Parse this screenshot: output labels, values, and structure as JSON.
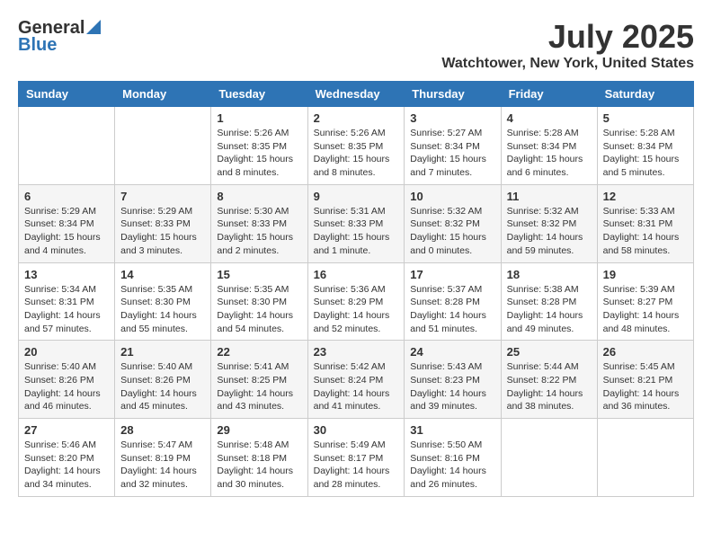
{
  "header": {
    "logo_general": "General",
    "logo_blue": "Blue",
    "title": "July 2025",
    "location": "Watchtower, New York, United States"
  },
  "calendar": {
    "days_of_week": [
      "Sunday",
      "Monday",
      "Tuesday",
      "Wednesday",
      "Thursday",
      "Friday",
      "Saturday"
    ],
    "weeks": [
      [
        {
          "day": "",
          "info": ""
        },
        {
          "day": "",
          "info": ""
        },
        {
          "day": "1",
          "info": "Sunrise: 5:26 AM\nSunset: 8:35 PM\nDaylight: 15 hours\nand 8 minutes."
        },
        {
          "day": "2",
          "info": "Sunrise: 5:26 AM\nSunset: 8:35 PM\nDaylight: 15 hours\nand 8 minutes."
        },
        {
          "day": "3",
          "info": "Sunrise: 5:27 AM\nSunset: 8:34 PM\nDaylight: 15 hours\nand 7 minutes."
        },
        {
          "day": "4",
          "info": "Sunrise: 5:28 AM\nSunset: 8:34 PM\nDaylight: 15 hours\nand 6 minutes."
        },
        {
          "day": "5",
          "info": "Sunrise: 5:28 AM\nSunset: 8:34 PM\nDaylight: 15 hours\nand 5 minutes."
        }
      ],
      [
        {
          "day": "6",
          "info": "Sunrise: 5:29 AM\nSunset: 8:34 PM\nDaylight: 15 hours\nand 4 minutes."
        },
        {
          "day": "7",
          "info": "Sunrise: 5:29 AM\nSunset: 8:33 PM\nDaylight: 15 hours\nand 3 minutes."
        },
        {
          "day": "8",
          "info": "Sunrise: 5:30 AM\nSunset: 8:33 PM\nDaylight: 15 hours\nand 2 minutes."
        },
        {
          "day": "9",
          "info": "Sunrise: 5:31 AM\nSunset: 8:33 PM\nDaylight: 15 hours\nand 1 minute."
        },
        {
          "day": "10",
          "info": "Sunrise: 5:32 AM\nSunset: 8:32 PM\nDaylight: 15 hours\nand 0 minutes."
        },
        {
          "day": "11",
          "info": "Sunrise: 5:32 AM\nSunset: 8:32 PM\nDaylight: 14 hours\nand 59 minutes."
        },
        {
          "day": "12",
          "info": "Sunrise: 5:33 AM\nSunset: 8:31 PM\nDaylight: 14 hours\nand 58 minutes."
        }
      ],
      [
        {
          "day": "13",
          "info": "Sunrise: 5:34 AM\nSunset: 8:31 PM\nDaylight: 14 hours\nand 57 minutes."
        },
        {
          "day": "14",
          "info": "Sunrise: 5:35 AM\nSunset: 8:30 PM\nDaylight: 14 hours\nand 55 minutes."
        },
        {
          "day": "15",
          "info": "Sunrise: 5:35 AM\nSunset: 8:30 PM\nDaylight: 14 hours\nand 54 minutes."
        },
        {
          "day": "16",
          "info": "Sunrise: 5:36 AM\nSunset: 8:29 PM\nDaylight: 14 hours\nand 52 minutes."
        },
        {
          "day": "17",
          "info": "Sunrise: 5:37 AM\nSunset: 8:28 PM\nDaylight: 14 hours\nand 51 minutes."
        },
        {
          "day": "18",
          "info": "Sunrise: 5:38 AM\nSunset: 8:28 PM\nDaylight: 14 hours\nand 49 minutes."
        },
        {
          "day": "19",
          "info": "Sunrise: 5:39 AM\nSunset: 8:27 PM\nDaylight: 14 hours\nand 48 minutes."
        }
      ],
      [
        {
          "day": "20",
          "info": "Sunrise: 5:40 AM\nSunset: 8:26 PM\nDaylight: 14 hours\nand 46 minutes."
        },
        {
          "day": "21",
          "info": "Sunrise: 5:40 AM\nSunset: 8:26 PM\nDaylight: 14 hours\nand 45 minutes."
        },
        {
          "day": "22",
          "info": "Sunrise: 5:41 AM\nSunset: 8:25 PM\nDaylight: 14 hours\nand 43 minutes."
        },
        {
          "day": "23",
          "info": "Sunrise: 5:42 AM\nSunset: 8:24 PM\nDaylight: 14 hours\nand 41 minutes."
        },
        {
          "day": "24",
          "info": "Sunrise: 5:43 AM\nSunset: 8:23 PM\nDaylight: 14 hours\nand 39 minutes."
        },
        {
          "day": "25",
          "info": "Sunrise: 5:44 AM\nSunset: 8:22 PM\nDaylight: 14 hours\nand 38 minutes."
        },
        {
          "day": "26",
          "info": "Sunrise: 5:45 AM\nSunset: 8:21 PM\nDaylight: 14 hours\nand 36 minutes."
        }
      ],
      [
        {
          "day": "27",
          "info": "Sunrise: 5:46 AM\nSunset: 8:20 PM\nDaylight: 14 hours\nand 34 minutes."
        },
        {
          "day": "28",
          "info": "Sunrise: 5:47 AM\nSunset: 8:19 PM\nDaylight: 14 hours\nand 32 minutes."
        },
        {
          "day": "29",
          "info": "Sunrise: 5:48 AM\nSunset: 8:18 PM\nDaylight: 14 hours\nand 30 minutes."
        },
        {
          "day": "30",
          "info": "Sunrise: 5:49 AM\nSunset: 8:17 PM\nDaylight: 14 hours\nand 28 minutes."
        },
        {
          "day": "31",
          "info": "Sunrise: 5:50 AM\nSunset: 8:16 PM\nDaylight: 14 hours\nand 26 minutes."
        },
        {
          "day": "",
          "info": ""
        },
        {
          "day": "",
          "info": ""
        }
      ]
    ]
  }
}
